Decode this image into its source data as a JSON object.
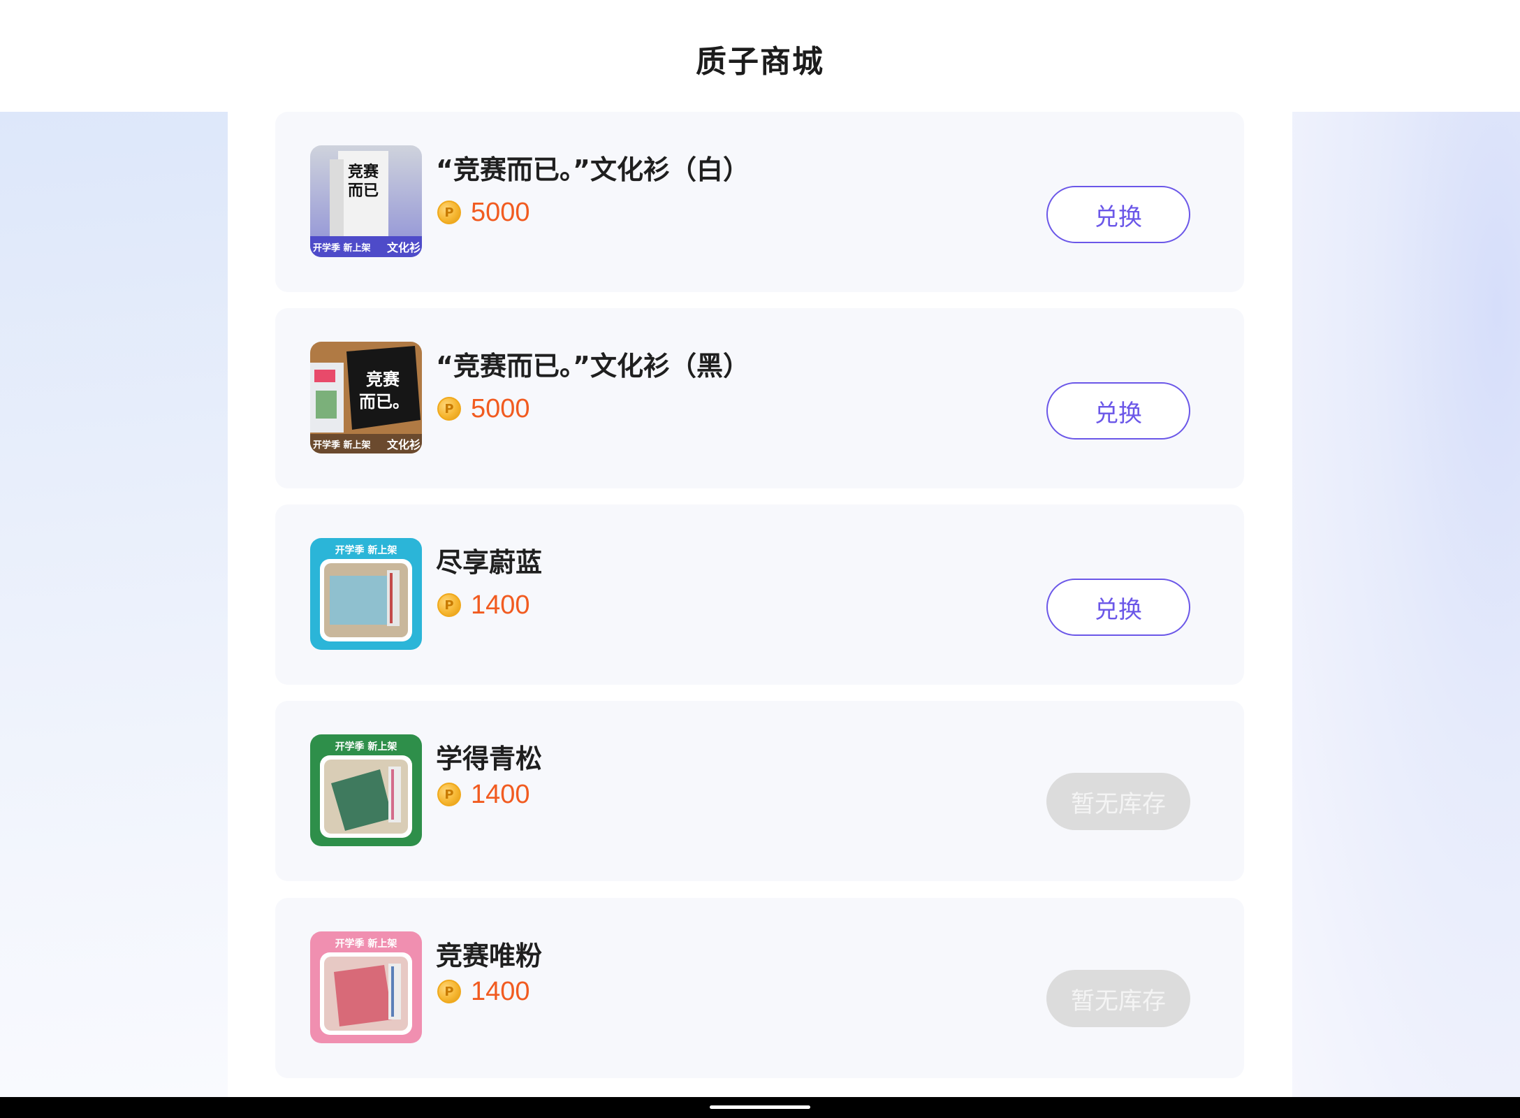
{
  "header": {
    "title": "质子商城"
  },
  "currency_icon": "coin-icon",
  "items": [
    {
      "title": "“竞赛而已。”文化衫（白）",
      "price": "5000",
      "button": "兑换",
      "status": "available"
    },
    {
      "title": "“竞赛而已。”文化衫（黑）",
      "price": "5000",
      "button": "兑换",
      "status": "available"
    },
    {
      "title": "尽享蔚蓝",
      "price": "1400",
      "button": "兑换",
      "status": "available"
    },
    {
      "title": "学得青松",
      "price": "1400",
      "button": "暂无库存",
      "status": "sold-out"
    },
    {
      "title": "竞赛唯粉",
      "price": "1400",
      "button": "暂无库存",
      "status": "sold-out"
    }
  ],
  "thumb_text": {
    "banner": "开学季 新上架",
    "shirt_label": "文化衫",
    "shirt_slogan": "竞赛而已"
  },
  "colors": {
    "accent": "#6b57e8",
    "price": "#f15b20",
    "sold_out_bg": "#dcdcdc"
  }
}
